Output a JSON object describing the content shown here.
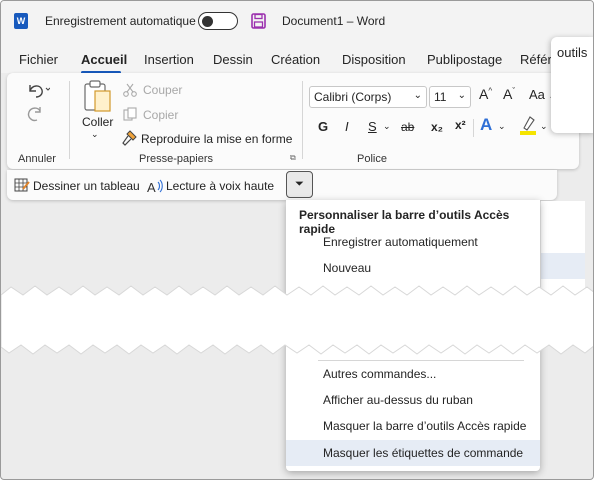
{
  "titlebar": {
    "app_logo": "W",
    "autosave_label": "Enregistrement automatique",
    "doc_title": "Document1 – Word"
  },
  "tabs": [
    {
      "label": "Fichier"
    },
    {
      "label": "Accueil"
    },
    {
      "label": "Insertion"
    },
    {
      "label": "Dessin"
    },
    {
      "label": "Création"
    },
    {
      "label": "Disposition"
    },
    {
      "label": "Publipostage"
    },
    {
      "label": "Référe"
    }
  ],
  "outils_tab": "outils",
  "ribbon": {
    "annuler": {
      "label": "Annuler"
    },
    "clipboard": {
      "paste_label": "Coller",
      "cut_label": "Couper",
      "copy_label": "Copier",
      "format_painter_label": "Reproduire la mise en forme",
      "group_label": "Presse-papiers"
    },
    "font": {
      "font_name": "Calibri (Corps)",
      "font_size": "11",
      "bold": "G",
      "italic": "I",
      "underline": "S",
      "strike": "ab",
      "subscript": "x₂",
      "superscript": "x²",
      "grow": "A^",
      "shrink": "Aˇ",
      "change_case": "Aa",
      "text_effects": "A",
      "group_label": "Police"
    }
  },
  "qat": {
    "draw_table_label": "Dessiner un tableau",
    "read_aloud_label": "Lecture à voix haute"
  },
  "menu": {
    "title": "Personnaliser la barre d’outils Accès rapide",
    "items_top": [
      {
        "label": "Enregistrer automatiquement"
      },
      {
        "label": "Nouveau"
      }
    ],
    "items_bottom": [
      {
        "label": "Autres commandes..."
      },
      {
        "label": "Afficher au-dessus du ruban"
      },
      {
        "label": "Masquer la barre d’outils Accès rapide"
      },
      {
        "label": "Masquer les étiquettes de commande"
      }
    ]
  },
  "colors": {
    "accent": "#185abd",
    "save_icon": "#9b2fae",
    "highlight_hover": "#e6ecf5",
    "highlighter_yellow": "#f5e400",
    "text_effects_blue": "#2f6fd6"
  }
}
